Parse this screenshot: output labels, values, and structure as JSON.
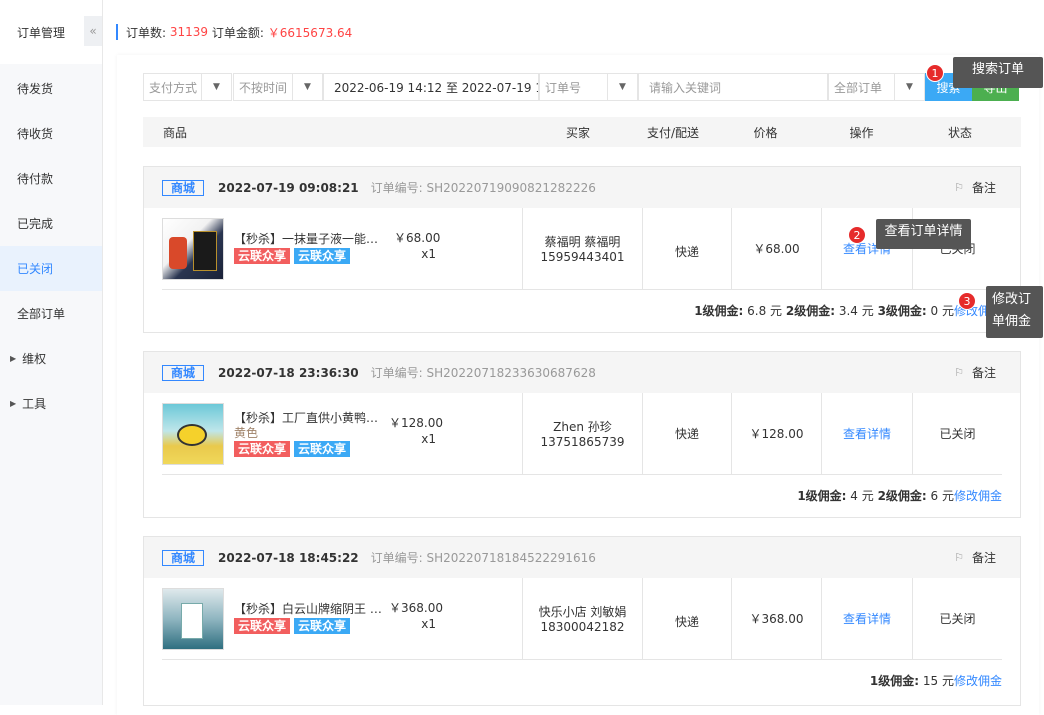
{
  "sidebar": {
    "title": "订单管理",
    "collapse_icon": "«",
    "items": [
      {
        "label": "待发货",
        "active": false
      },
      {
        "label": "待收货",
        "active": false
      },
      {
        "label": "待付款",
        "active": false
      },
      {
        "label": "已完成",
        "active": false
      },
      {
        "label": "已关闭",
        "active": true
      },
      {
        "label": "全部订单",
        "active": false
      },
      {
        "label": "维权",
        "expand": true
      },
      {
        "label": "工具",
        "expand": true
      }
    ]
  },
  "summary": {
    "count_label": "订单数:",
    "count": "31139",
    "amount_label": "订单金额:",
    "amount": "￥6615673.64"
  },
  "filters": {
    "pay_method": "支付方式",
    "time_filter": "不按时间",
    "date_range": "2022-06-19 14:12 至 2022-07-19 14:12",
    "field": "订单号",
    "keyword_placeholder": "请输入关键词",
    "order_type": "全部订单",
    "search_label": "搜索",
    "export_label": "导出"
  },
  "table_header": {
    "product": "商品",
    "buyer": "买家",
    "pay_ship": "支付/配送",
    "price": "价格",
    "action": "操作",
    "status": "状态"
  },
  "orders": [
    {
      "tag": "商城",
      "date": "2022-07-19  09:08:21",
      "order_no": "订单编号: SH20220719090821282226",
      "remark": "备注",
      "product_name": "【秒杀】一抹量子液一能量...",
      "product_color": "",
      "unit_price": "￥68.00",
      "qty": "x1",
      "chip1": "云联众享",
      "chip2": "云联众享",
      "buyer_name": "蔡福明  蔡福明",
      "buyer_phone": "15959443401",
      "delivery": "快递",
      "price": "￥68.00",
      "detail": "查看详情",
      "status": "已关闭",
      "commission": "<b>1级佣金:</b> 6.8 元 <b>2级佣金:</b> 3.4 元 <b>3级佣金:</b> 0 元 ",
      "commission_link": "修改佣金"
    },
    {
      "tag": "商城",
      "date": "2022-07-18  23:36:30",
      "order_no": "订单编号: SH20220718233630687628",
      "remark": "备注",
      "product_name": "【秒杀】工厂直供小黄鸭微...",
      "product_color": "黄色",
      "unit_price": "￥128.00",
      "qty": "x1",
      "chip1": "云联众享",
      "chip2": "云联众享",
      "buyer_name": "Zhen  孙珍",
      "buyer_phone": "13751865739",
      "delivery": "快递",
      "price": "￥128.00",
      "detail": "查看详情",
      "status": "已关闭",
      "commission": "<b>1级佣金:</b> 4 元 <b>2级佣金:</b> 6 元 ",
      "commission_link": "修改佣金"
    },
    {
      "tag": "商城",
      "date": "2022-07-18  18:45:22",
      "order_no": "订单编号: SH20220718184522291616",
      "remark": "备注",
      "product_name": "【秒杀】白云山牌缩阴王 妇...",
      "product_color": "",
      "unit_price": "￥368.00",
      "qty": "x1",
      "chip1": "云联众享",
      "chip2": "云联众享",
      "buyer_name": "快乐小店  刘敏娟",
      "buyer_phone": "18300042182",
      "delivery": "快递",
      "price": "￥368.00",
      "detail": "查看详情",
      "status": "已关闭",
      "commission": "<b>1级佣金:</b> 15 元 ",
      "commission_link": "修改佣金"
    }
  ],
  "tooltips": {
    "t1_num": "1",
    "t1": "搜索订单",
    "t2_num": "2",
    "t2": "查看订单详情",
    "t3_num": "3",
    "t3_line1": "修改订",
    "t3_line2": "单佣金"
  },
  "colors": {
    "accent": "#3388ff",
    "search_btn": "#3ba9f5",
    "export_btn": "#4caf50",
    "red": "#f44444"
  }
}
